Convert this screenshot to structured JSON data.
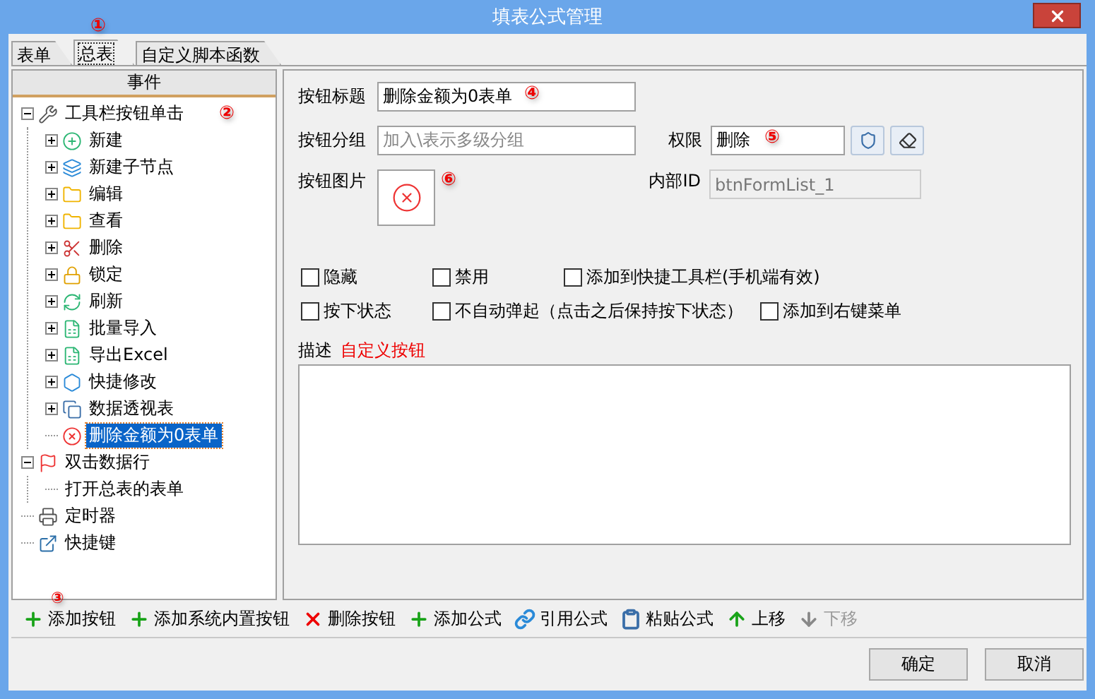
{
  "window": {
    "title": "填表公式管理"
  },
  "tabs": [
    {
      "label": "表单",
      "selected": false
    },
    {
      "label": "总表",
      "selected": true,
      "marker": "①"
    },
    {
      "label": "自定义脚本函数",
      "selected": false
    }
  ],
  "tree": {
    "header": "事件",
    "nodes": [
      {
        "label": "工具栏按钮单击",
        "kind": "wrench",
        "expandable": true,
        "expanded": true,
        "selected": false,
        "marker": "②",
        "children": [
          {
            "label": "新建",
            "kind": "plus-circle",
            "expandable": true,
            "expanded": false,
            "selected": false
          },
          {
            "label": "新建子节点",
            "kind": "layers",
            "expandable": true,
            "expanded": false,
            "selected": false
          },
          {
            "label": "编辑",
            "kind": "folder",
            "expandable": true,
            "expanded": false,
            "selected": false
          },
          {
            "label": "查看",
            "kind": "folder",
            "expandable": true,
            "expanded": false,
            "selected": false
          },
          {
            "label": "删除",
            "kind": "delete",
            "expandable": true,
            "expanded": false,
            "selected": false
          },
          {
            "label": "锁定",
            "kind": "lock",
            "expandable": true,
            "expanded": false,
            "selected": false
          },
          {
            "label": "刷新",
            "kind": "refresh",
            "expandable": true,
            "expanded": false,
            "selected": false
          },
          {
            "label": "批量导入",
            "kind": "sheet",
            "expandable": true,
            "expanded": false,
            "selected": false
          },
          {
            "label": "导出Excel",
            "kind": "sheet",
            "expandable": true,
            "expanded": false,
            "selected": false
          },
          {
            "label": "快捷修改",
            "kind": "hexagon",
            "expandable": true,
            "expanded": false,
            "selected": false
          },
          {
            "label": "数据透视表",
            "kind": "copy",
            "expandable": true,
            "expanded": false,
            "selected": false
          },
          {
            "label": "删除金额为0表单",
            "kind": "x-circle",
            "expandable": false,
            "selected": true
          }
        ]
      },
      {
        "label": "双击数据行",
        "kind": "flag",
        "expandable": true,
        "expanded": true,
        "selected": false,
        "children": [
          {
            "label": "打开总表的表单",
            "kind": "none",
            "expandable": false,
            "selected": false
          }
        ]
      },
      {
        "label": "定时器",
        "kind": "printer",
        "expandable": false,
        "selected": false
      },
      {
        "label": "快捷键",
        "kind": "external",
        "expandable": false,
        "selected": false
      }
    ]
  },
  "form": {
    "title": {
      "label": "按钮标题",
      "value": "删除金额为0表单",
      "marker": "④"
    },
    "group": {
      "label": "按钮分组",
      "placeholder": "加入\\表示多级分组"
    },
    "permission": {
      "label": "权限",
      "value": "删除",
      "marker": "⑤"
    },
    "image": {
      "label": "按钮图片",
      "marker": "⑥"
    },
    "internal_id": {
      "label": "内部ID",
      "value": "btnFormList_1",
      "disabled": true
    },
    "checkbox_rows": [
      [
        {
          "label": "隐藏",
          "checked": false
        },
        {
          "label": "禁用",
          "checked": false
        },
        {
          "label": "添加到快捷工具栏(手机端有效)",
          "checked": false
        }
      ],
      [
        {
          "label": "按下状态",
          "checked": false
        },
        {
          "label": "不自动弹起（点击之后保持按下状态）",
          "checked": false
        },
        {
          "label": "添加到右键菜单",
          "checked": false
        }
      ]
    ],
    "description": {
      "label": "描述",
      "value": "自定义按钮"
    }
  },
  "toolbar": [
    {
      "label": "添加按钮",
      "kind": "plus",
      "disabled": false,
      "marker": "③"
    },
    {
      "label": "添加系统内置按钮",
      "kind": "plus",
      "disabled": false
    },
    {
      "label": "删除按钮",
      "kind": "x",
      "disabled": false
    },
    {
      "label": "添加公式",
      "kind": "plus",
      "disabled": false
    },
    {
      "label": "引用公式",
      "kind": "link",
      "disabled": false
    },
    {
      "label": "粘贴公式",
      "kind": "clipboard",
      "disabled": false
    },
    {
      "label": "上移",
      "kind": "up",
      "disabled": false
    },
    {
      "label": "下移",
      "kind": "down",
      "disabled": true
    }
  ],
  "buttons": [
    "确定",
    "取消"
  ]
}
